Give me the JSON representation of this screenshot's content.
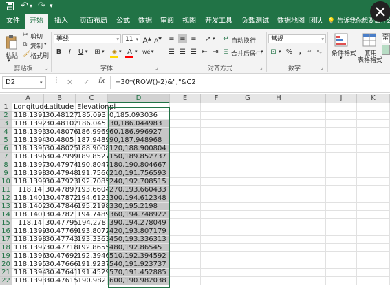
{
  "qat": {
    "save_icon": "save-icon",
    "undo_icon": "undo-icon",
    "redo_icon": "redo-icon"
  },
  "ribbon_tabs": [
    {
      "label": "文件"
    },
    {
      "label": "开始"
    },
    {
      "label": "插入"
    },
    {
      "label": "页面布局"
    },
    {
      "label": "公式"
    },
    {
      "label": "数据"
    },
    {
      "label": "审阅"
    },
    {
      "label": "视图"
    },
    {
      "label": "开发工具"
    },
    {
      "label": "负载测试"
    },
    {
      "label": "数据地图"
    },
    {
      "label": "团队"
    }
  ],
  "active_tab": "开始",
  "tell_me": "告诉我你想要做什么",
  "clipboard": {
    "paste": "粘贴",
    "cut": "剪切",
    "copy": "复制",
    "format_painter": "格式刷",
    "group": "剪贴板"
  },
  "font": {
    "name": "等线",
    "size": "11",
    "group": "字体",
    "bold": "B",
    "italic": "I",
    "underline": "U",
    "grow": "A",
    "shrink": "A",
    "font_color": "A",
    "wen": "wén",
    "clear": "ǎ"
  },
  "alignment": {
    "wrap_text": "自动换行",
    "merge_center": "合并后居中",
    "group": "对齐方式"
  },
  "number": {
    "format": "常规",
    "percent": "%",
    "comma": ",",
    "group": "数字"
  },
  "styles": {
    "conditional": "条件格式",
    "table_format_1": "套用",
    "table_format_2": "表格格式",
    "cell_style_partial": "常"
  },
  "formula_bar": {
    "name_box": "D2",
    "fx": "fx",
    "formula": "=30*(ROW()-2)&\",\"&C2"
  },
  "sheet": {
    "columns": [
      "A",
      "B",
      "C",
      "D",
      "E",
      "F",
      "G",
      "H",
      "I",
      "J",
      "K"
    ],
    "selected_column": "D",
    "rows": [
      {
        "n": "1",
        "a": "Longitude",
        "b": "Latitude",
        "c": "Elevation",
        "d": "pl"
      },
      {
        "n": "2",
        "a": "118.1391",
        "b": "30.48127",
        "c": "185.093",
        "d": "0,185.093036"
      },
      {
        "n": "3",
        "a": "118.1392",
        "b": "30.48102",
        "c": "186.045",
        "d": "30,186.044983"
      },
      {
        "n": "4",
        "a": "118.1393",
        "b": "30.48076",
        "c": "186.9969",
        "d": "60,186.996927"
      },
      {
        "n": "5",
        "a": "118.1394",
        "b": "30.4805",
        "c": "187.9489",
        "d": "90,187.948968"
      },
      {
        "n": "6",
        "a": "118.1395",
        "b": "30.48025",
        "c": "188.9008",
        "d": "120,188.900804"
      },
      {
        "n": "7",
        "a": "118.1396",
        "b": "30.47999",
        "c": "189.8527",
        "d": "150,189.852737"
      },
      {
        "n": "8",
        "a": "118.1397",
        "b": "30.47974",
        "c": "190.8047",
        "d": "180,190.804667"
      },
      {
        "n": "9",
        "a": "118.1398",
        "b": "30.47948",
        "c": "191.7566",
        "d": "210,191.756593"
      },
      {
        "n": "10",
        "a": "118.1399",
        "b": "30.47923",
        "c": "192.7085",
        "d": "240,192.708515"
      },
      {
        "n": "11",
        "a": "118.14",
        "b": "30.47897",
        "c": "193.6604",
        "d": "270,193.660433"
      },
      {
        "n": "12",
        "a": "118.1401",
        "b": "30.47872",
        "c": "194.6123",
        "d": "300,194.612348"
      },
      {
        "n": "13",
        "a": "118.1402",
        "b": "30.47846",
        "c": "195.2198",
        "d": "330,195.2198"
      },
      {
        "n": "14",
        "a": "118.1401",
        "b": "30.4782",
        "c": "194.7489",
        "d": "360,194.748922"
      },
      {
        "n": "15",
        "a": "118.14",
        "b": "30.47795",
        "c": "194.278",
        "d": "390,194.278049"
      },
      {
        "n": "16",
        "a": "118.1399",
        "b": "30.47769",
        "c": "193.8072",
        "d": "420,193.807179"
      },
      {
        "n": "17",
        "a": "118.1398",
        "b": "30.47743",
        "c": "193.3363",
        "d": "450,193.336313"
      },
      {
        "n": "18",
        "a": "118.1397",
        "b": "30.47718",
        "c": "192.8655",
        "d": "480,192.86545"
      },
      {
        "n": "19",
        "a": "118.1396",
        "b": "30.47692",
        "c": "192.3946",
        "d": "510,192.394592"
      },
      {
        "n": "20",
        "a": "118.1395",
        "b": "30.47666",
        "c": "191.9237",
        "d": "540,191.923737"
      },
      {
        "n": "21",
        "a": "118.1394",
        "b": "30.47641",
        "c": "191.4529",
        "d": "570,191.452885"
      },
      {
        "n": "22",
        "a": "118.1393",
        "b": "30.47615",
        "c": "190.982",
        "d": "600,190.982038"
      }
    ]
  },
  "colors": {
    "excel_green": "#217346",
    "selection_gray": "#c6c6c6"
  }
}
